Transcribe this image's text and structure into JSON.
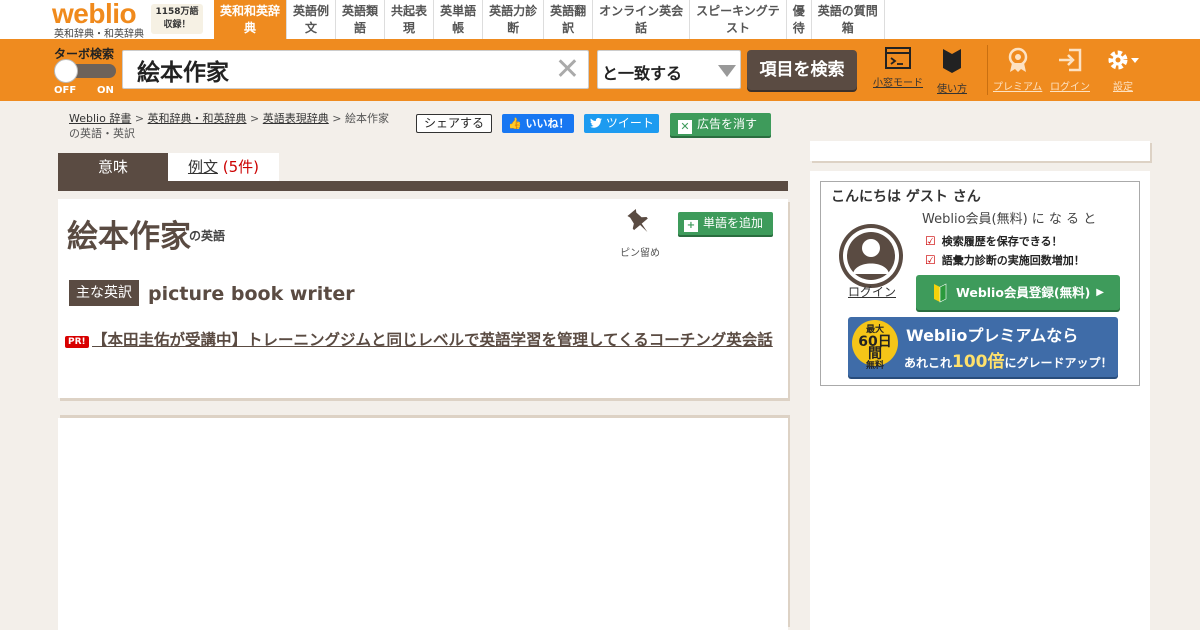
{
  "header": {
    "logo": "weblio",
    "logo_sub": "英和辞典・和英辞典",
    "count_line1": "1158万語",
    "count_line2": "収録！",
    "nav": [
      {
        "line1": "英和和英辞",
        "line2": "典",
        "active": true
      },
      {
        "line1": "英語例",
        "line2": "文"
      },
      {
        "line1": "英語類",
        "line2": "語"
      },
      {
        "line1": "共起表",
        "line2": "現"
      },
      {
        "line1": "英単語",
        "line2": "帳"
      },
      {
        "line1": "英語力診",
        "line2": "断"
      },
      {
        "line1": "英語翻",
        "line2": "訳"
      },
      {
        "line1": "オンライン英会",
        "line2": "話"
      },
      {
        "line1": "スピーキングテ",
        "line2": "スト"
      },
      {
        "line1": "優",
        "line2": "待"
      },
      {
        "line1": "英語の質問",
        "line2": "箱"
      }
    ]
  },
  "search": {
    "turbo_label": "ターボ検索",
    "turbo_off": "OFF",
    "turbo_on": "ON",
    "query": "絵本作家",
    "clear_glyph": "✕",
    "match_mode": "と一致する",
    "button": "項目を検索",
    "tools": {
      "small_window": "小窓モード",
      "how_to": "使い方",
      "premium": "プレミアム",
      "login": "ログイン",
      "settings": "設定"
    }
  },
  "breadcrumb": {
    "items": [
      "Weblio 辞書",
      "英和辞典・和英辞典",
      "英語表現辞典"
    ],
    "sep": " > ",
    "current": "絵本作家の英語・英訳"
  },
  "social": {
    "share": "シェアする",
    "like": "いいね！",
    "tweet": "ツイート",
    "hide_ads": "広告を消す"
  },
  "tabs": {
    "meaning": "意味",
    "examples": "例文",
    "examples_count": "(5件)"
  },
  "entry": {
    "headword": "絵本作家",
    "suffix": "の英語",
    "pin_label": "ピン留め",
    "add_word": "単語を追加",
    "main_label": "主な英訳",
    "translation": "picture book writer",
    "pr_badge": "PR!",
    "pr_text": "【本田圭佑が受講中】トレーニングジムと同じレベルで英語学習を管理してくるコーチング英会話"
  },
  "sidebar": {
    "greeting": "こんにちは ゲスト さん",
    "login_link": "ログイン",
    "member_lead": "Weblio会員(無料) に な る と",
    "benefits": [
      "検索履歴を保存できる！",
      "語彙力診断の実施回数増加！"
    ],
    "register_button": "Weblio会員登録(無料)",
    "premium": {
      "badge_line1": "最大",
      "badge_line2": "60日間",
      "badge_line3": "無料",
      "line1": "Weblioプレミアムなら",
      "line2_pre": "あれこれ",
      "line2_hl": "100倍",
      "line2_post": "にグレードアップ！"
    }
  },
  "colors": {
    "brand_orange": "#ef8b1f",
    "dark_brown": "#5a4b42",
    "green_button": "#3e9b5b",
    "facebook_blue": "#1877f2",
    "twitter_blue": "#1d9bf0",
    "background": "#f3efea"
  }
}
